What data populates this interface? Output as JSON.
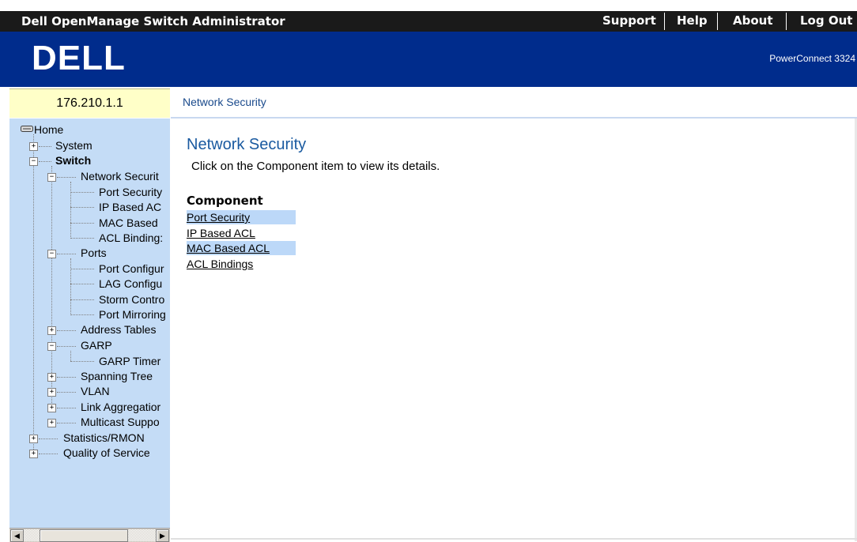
{
  "header": {
    "app_title": "Dell OpenManage Switch Administrator",
    "links": [
      "Support",
      "Help",
      "About",
      "Log Out"
    ]
  },
  "banner": {
    "logo_text": "DELL",
    "product": "PowerConnect 3324"
  },
  "device": {
    "ip": "176.210.1.1"
  },
  "breadcrumb": "Network Security",
  "tree": [
    {
      "label": "Home",
      "icon": "drive-icon"
    },
    {
      "label": "System",
      "expander": "+"
    },
    {
      "label": "Switch",
      "expander": "-",
      "selected": true
    },
    {
      "label": "Network Securit",
      "expander": "-"
    },
    {
      "label": "Port Security"
    },
    {
      "label": "IP Based AC"
    },
    {
      "label": "MAC Based"
    },
    {
      "label": "ACL Binding:"
    },
    {
      "label": "Ports",
      "expander": "-"
    },
    {
      "label": "Port Configur"
    },
    {
      "label": "LAG Configu"
    },
    {
      "label": "Storm Contro"
    },
    {
      "label": "Port Mirroring"
    },
    {
      "label": "Address Tables",
      "expander": "+"
    },
    {
      "label": "GARP",
      "expander": "-"
    },
    {
      "label": "GARP Timer"
    },
    {
      "label": "Spanning Tree",
      "expander": "+"
    },
    {
      "label": "VLAN",
      "expander": "+"
    },
    {
      "label": "Link Aggregatior",
      "expander": "+"
    },
    {
      "label": "Multicast Suppo",
      "expander": "+"
    },
    {
      "label": "Statistics/RMON",
      "expander": "+"
    },
    {
      "label": "Quality of Service",
      "expander": "+"
    }
  ],
  "main": {
    "title": "Network Security",
    "description": "Click on the Component item to view its details.",
    "component_header": "Component",
    "components": [
      "Port Security",
      "IP Based ACL",
      "MAC Based ACL",
      "ACL Bindings"
    ]
  },
  "colors": {
    "banner": "#002c8c",
    "tree_bg": "#c4dcf6",
    "ip_bg": "#ffffc8",
    "link_highlight": "#bcd8f8"
  }
}
